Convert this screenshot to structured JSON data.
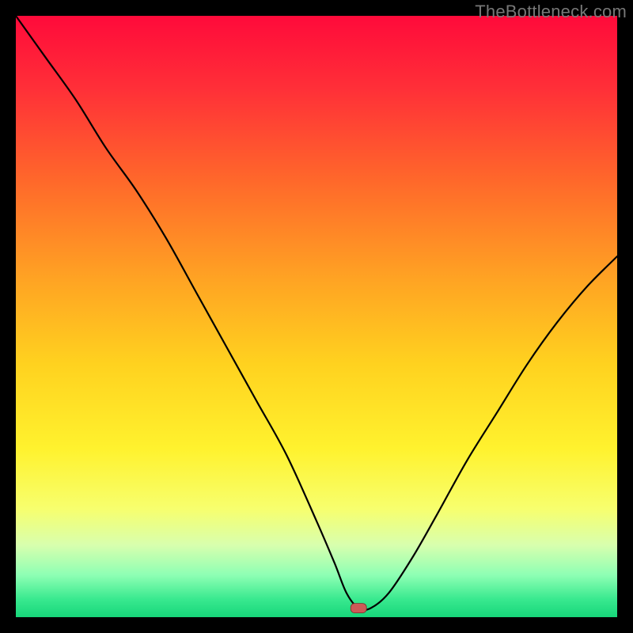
{
  "watermark": "TheBottleneck.com",
  "colors": {
    "gradient_stops": [
      {
        "offset": 0.0,
        "color": "#ff0a3a"
      },
      {
        "offset": 0.12,
        "color": "#ff2f38"
      },
      {
        "offset": 0.28,
        "color": "#ff6a2a"
      },
      {
        "offset": 0.44,
        "color": "#ffa423"
      },
      {
        "offset": 0.58,
        "color": "#ffd21f"
      },
      {
        "offset": 0.72,
        "color": "#fff22e"
      },
      {
        "offset": 0.82,
        "color": "#f7ff6e"
      },
      {
        "offset": 0.88,
        "color": "#d8ffae"
      },
      {
        "offset": 0.93,
        "color": "#8effb4"
      },
      {
        "offset": 0.97,
        "color": "#39e98f"
      },
      {
        "offset": 1.0,
        "color": "#17d67a"
      }
    ],
    "curve_stroke": "#000000",
    "marker_fill": "#cc5a57",
    "marker_stroke": "#7a2d2b"
  },
  "chart_data": {
    "type": "line",
    "title": "",
    "xlabel": "",
    "ylabel": "",
    "xlim": [
      0,
      100
    ],
    "ylim": [
      0,
      100
    ],
    "grid": false,
    "legend": false,
    "annotations": [
      {
        "text": "TheBottleneck.com",
        "role": "watermark",
        "position": "top-right"
      }
    ],
    "marker": {
      "x": 57,
      "y": 1.5,
      "shape": "rounded-rect"
    },
    "series": [
      {
        "name": "bottleneck-curve",
        "x": [
          0,
          5,
          10,
          15,
          20,
          25,
          30,
          35,
          40,
          45,
          50,
          53,
          55,
          57,
          59,
          62,
          66,
          70,
          75,
          80,
          85,
          90,
          95,
          100
        ],
        "y": [
          100,
          93,
          86,
          78,
          71,
          63,
          54,
          45,
          36,
          27,
          16,
          9,
          4,
          1.5,
          1.5,
          4,
          10,
          17,
          26,
          34,
          42,
          49,
          55,
          60
        ]
      }
    ]
  }
}
